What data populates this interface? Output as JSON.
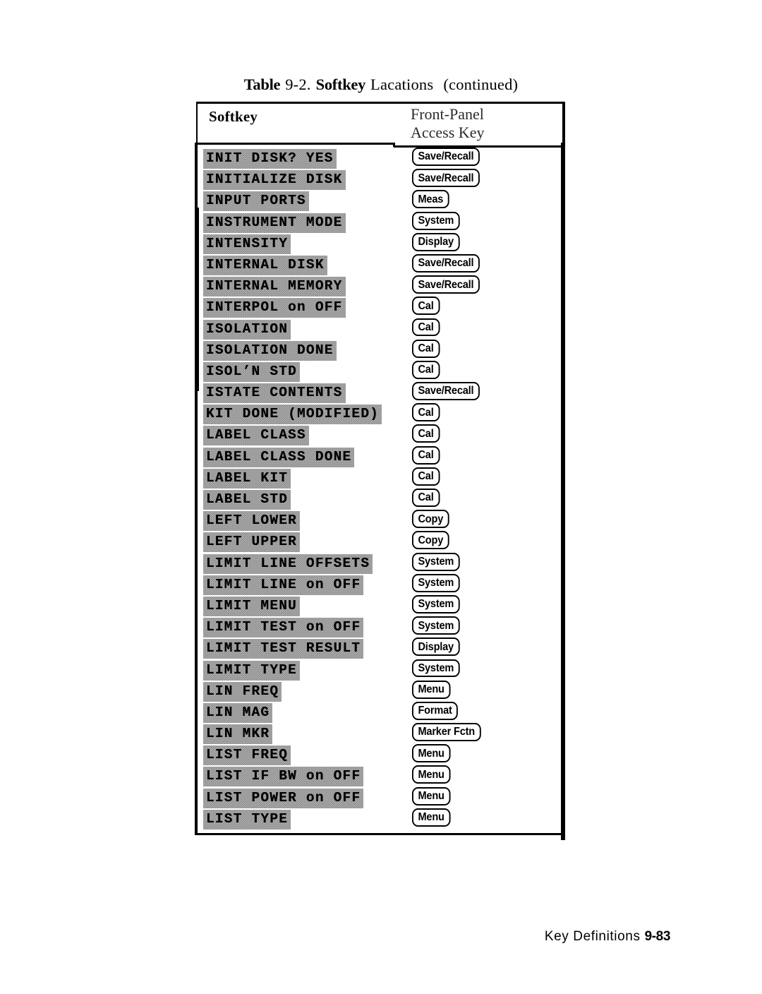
{
  "caption": {
    "table_word": "Table",
    "number": "9-2.",
    "softkey_word": "Softkey",
    "rest": "Lacations",
    "continued": "(continued)"
  },
  "table": {
    "columns": {
      "softkey": "Softkey",
      "access_key_line1": "Front-Panel",
      "access_key_line2": "Access Key"
    },
    "rows": [
      {
        "softkey": "INIT DISK? YES",
        "access_key": "Save/Recall"
      },
      {
        "softkey": "INITIALIZE DISK",
        "access_key": "Save/Recall"
      },
      {
        "softkey": "INPUT PORTS",
        "access_key": "Meas"
      },
      {
        "softkey": "INSTRUMENT MODE",
        "access_key": "System"
      },
      {
        "softkey": "INTENSITY",
        "access_key": "Display"
      },
      {
        "softkey": "INTERNAL DISK",
        "access_key": "Save/Recall"
      },
      {
        "softkey": "INTERNAL MEMORY",
        "access_key": "Save/Recall"
      },
      {
        "softkey": "INTERPOL on OFF",
        "access_key": "Cal"
      },
      {
        "softkey": "ISOLATION",
        "access_key": "Cal"
      },
      {
        "softkey": "ISOLATION DONE",
        "access_key": "Cal"
      },
      {
        "softkey": "ISOL’N STD",
        "access_key": "Cal"
      },
      {
        "softkey": "ISTATE CONTENTS",
        "access_key": "Save/Recall"
      },
      {
        "softkey": "KIT DONE (MODIFIED)",
        "access_key": "Cal"
      },
      {
        "softkey": "LABEL CLASS",
        "access_key": "Cal"
      },
      {
        "softkey": "LABEL CLASS DONE",
        "access_key": "Cal"
      },
      {
        "softkey": "LABEL KIT",
        "access_key": "Cal"
      },
      {
        "softkey": "LABEL STD",
        "access_key": "Cal"
      },
      {
        "softkey": "LEFT LOWER",
        "access_key": "Copy"
      },
      {
        "softkey": "LEFT UPPER",
        "access_key": "Copy"
      },
      {
        "softkey": "LIMIT LINE OFFSETS",
        "access_key": "System"
      },
      {
        "softkey": "LIMIT LINE on OFF",
        "access_key": "System"
      },
      {
        "softkey": "LIMIT MENU",
        "access_key": "System"
      },
      {
        "softkey": "LIMIT TEST on OFF",
        "access_key": "System"
      },
      {
        "softkey": "LIMIT TEST RESULT",
        "access_key": "Display"
      },
      {
        "softkey": "LIMIT TYPE",
        "access_key": "System"
      },
      {
        "softkey": "LIN FREQ",
        "access_key": "Menu"
      },
      {
        "softkey": "LIN MAG",
        "access_key": "Format"
      },
      {
        "softkey": "LIN MKR",
        "access_key": "Marker Fctn"
      },
      {
        "softkey": "LIST FREQ",
        "access_key": "Menu"
      },
      {
        "softkey": "LIST IF BW on OFF",
        "access_key": "Menu"
      },
      {
        "softkey": "LIST POWER on OFF",
        "access_key": "Menu"
      },
      {
        "softkey": "LIST TYPE",
        "access_key": "Menu"
      }
    ]
  },
  "footer": {
    "label": "Key  Definitions",
    "page": "9-83"
  }
}
